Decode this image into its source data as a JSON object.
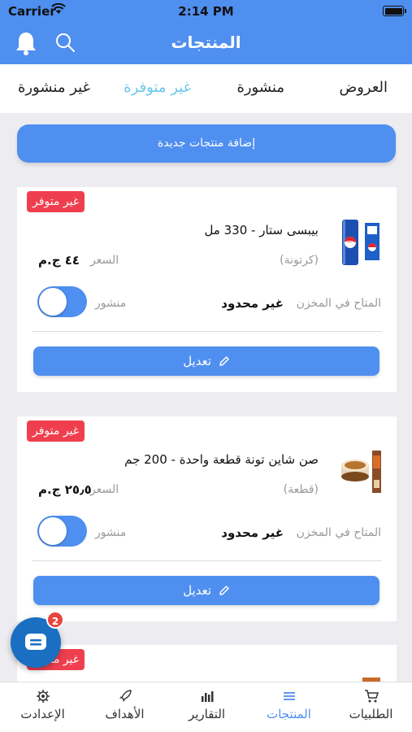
{
  "status": {
    "carrier": "Carrier",
    "time": "2:14 PM"
  },
  "nav": {
    "title": "المنتجات"
  },
  "tabs": [
    {
      "label": "العروض",
      "active": false
    },
    {
      "label": "منشورة",
      "active": false
    },
    {
      "label": "غير متوفرة",
      "active": true
    },
    {
      "label": "غير منشورة",
      "active": false
    }
  ],
  "add_button": "إضافة منتجات جديدة",
  "products": [
    {
      "badge": "غير متوفر",
      "name": "بيبسى ستار - 330 مل",
      "unit": "(كرتونة)",
      "price_label": "السعر",
      "price": "٤٤ ج.م",
      "stock_label": "المتاح في المخزن",
      "stock_value": "غير محدود",
      "published_label": "منشور",
      "published": true,
      "edit_label": "تعديل"
    },
    {
      "badge": "غير متوفر",
      "name": "صن شاين تونة قطعة واحدة - 200 جم",
      "unit": "(قطعة)",
      "price_label": "السعر",
      "price": "٢٥٫٥ ج.م",
      "stock_label": "المتاح في المخزن",
      "stock_value": "غير محدود",
      "published_label": "منشور",
      "published": true,
      "edit_label": "تعديل"
    },
    {
      "badge": "غير متوفر"
    }
  ],
  "chat": {
    "unread_count": "2"
  },
  "tabbar": [
    {
      "label": "الطلبيات",
      "icon": "cart-icon",
      "active": false
    },
    {
      "label": "المنتجات",
      "icon": "list-icon",
      "active": true
    },
    {
      "label": "التقارير",
      "icon": "bar-chart-icon",
      "active": false
    },
    {
      "label": "الأهداف",
      "icon": "rocket-icon",
      "active": false
    },
    {
      "label": "الإعدادت",
      "icon": "gear-icon",
      "active": false
    }
  ],
  "colors": {
    "primary": "#4f8ff0",
    "active_tab": "#6bc7ea",
    "badge": "#ef3f4f",
    "chat": "#1a6fc2"
  }
}
